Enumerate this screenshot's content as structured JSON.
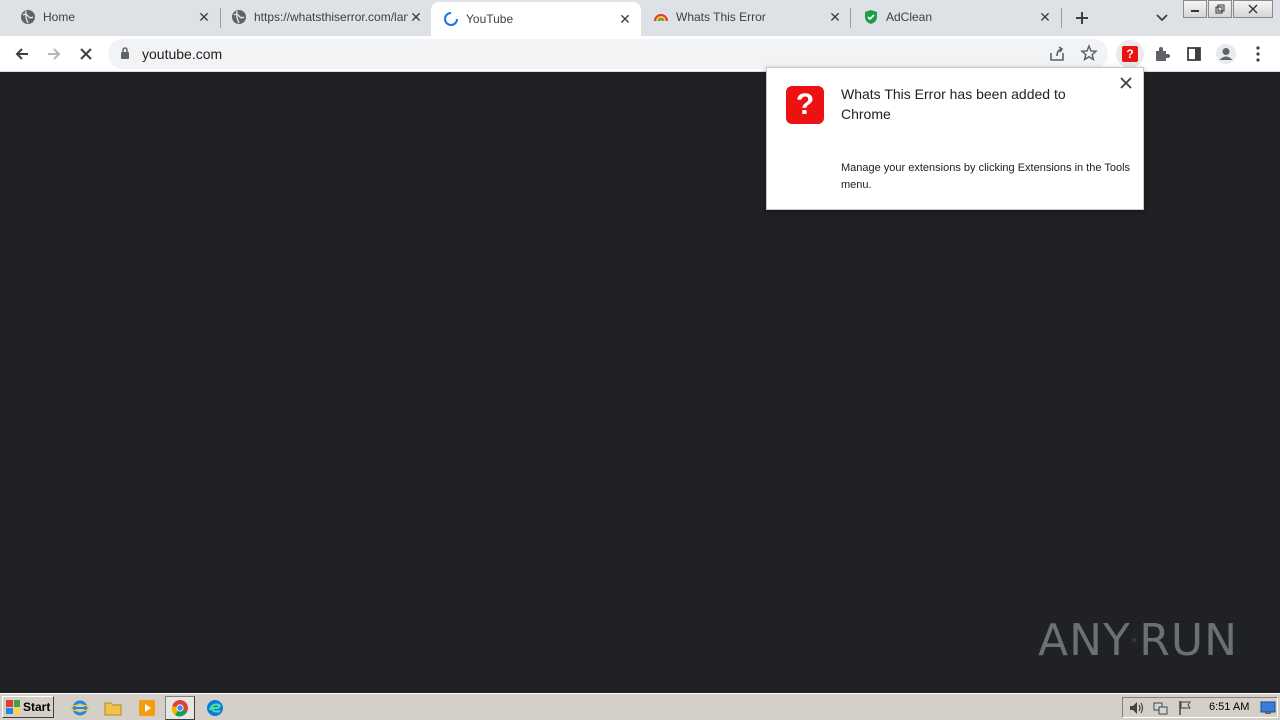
{
  "tabs": [
    {
      "title": "Home",
      "icon": "globe-icon"
    },
    {
      "title": "https://whatsthiserror.com/landing",
      "icon": "globe-icon"
    },
    {
      "title": "YouTube",
      "icon": "loading-spinner-icon",
      "active": true
    },
    {
      "title": "Whats This Error",
      "icon": "rainbow-icon"
    },
    {
      "title": "AdClean",
      "icon": "green-shield-icon"
    }
  ],
  "toolbar": {
    "url": "youtube.com"
  },
  "bubble": {
    "heading": "Whats This Error has been added to Chrome",
    "body": "Manage your extensions by clicking Extensions in the Tools menu.",
    "icon_color": "#ee1111"
  },
  "watermark": {
    "left": "ANY",
    "right": "RUN"
  },
  "taskbar": {
    "start_label": "Start",
    "clock": "6:51 AM"
  },
  "colors": {
    "page_bg": "#202124",
    "tabstrip_bg": "#dee1e6",
    "taskbar_bg": "#d4d0c8"
  }
}
